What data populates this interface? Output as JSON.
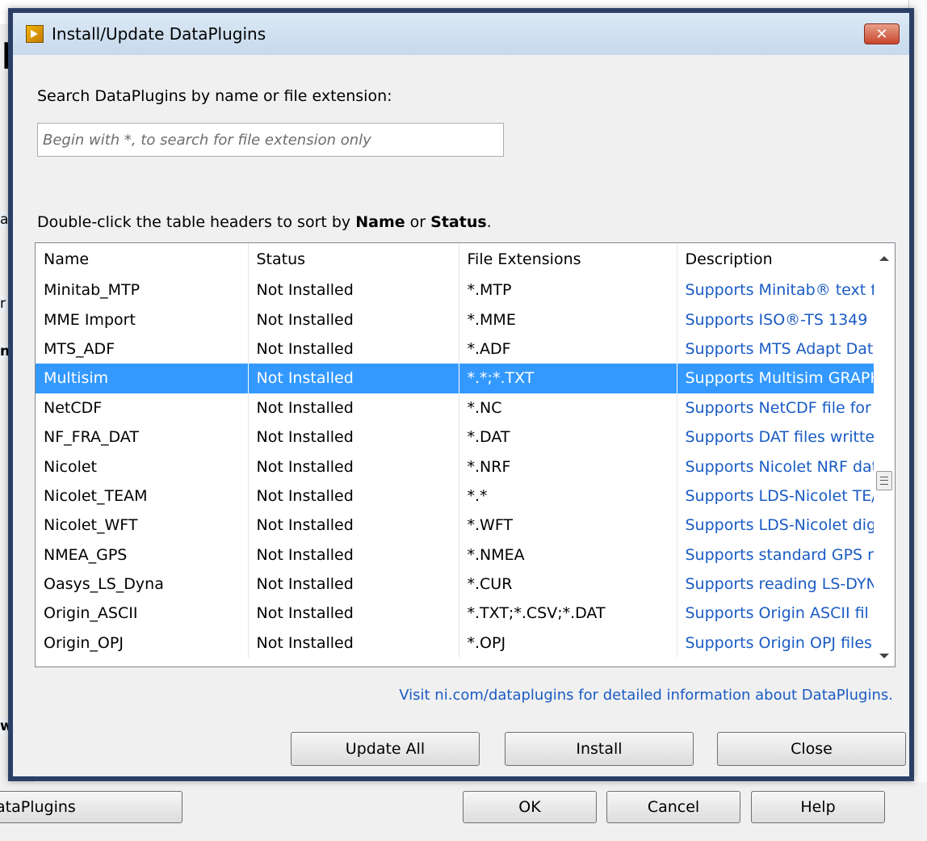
{
  "background": {
    "left_glyph": "n",
    "slivers": [
      "a",
      "r",
      "n",
      "w"
    ],
    "dataplugins_button": "ataPlugins",
    "ok_button": "OK",
    "cancel_button": "Cancel",
    "help_button": "Help"
  },
  "dialog": {
    "title": "Install/Update DataPlugins",
    "close_label": "✕",
    "search_label": "Search DataPlugins by name or file extension:",
    "search_placeholder": "Begin with *, to search for file extension only",
    "sort_hint_prefix": "Double-click the table headers to sort by ",
    "sort_hint_name": "Name",
    "sort_hint_or": " or ",
    "sort_hint_status": "Status",
    "sort_hint_suffix": ".",
    "table": {
      "columns": [
        "Name",
        "Status",
        "File Extensions",
        "Description"
      ],
      "rows": [
        {
          "name": "Minitab_MTP",
          "status": "Not Installed",
          "ext": "*.MTP",
          "desc": "Supports Minitab® text f"
        },
        {
          "name": "MME Import",
          "status": "Not Installed",
          "ext": "*.MME",
          "desc": "Supports ISO®-TS 1349"
        },
        {
          "name": "MTS_ADF",
          "status": "Not Installed",
          "ext": "*.ADF",
          "desc": "Supports MTS Adapt Dat"
        },
        {
          "name": "Multisim",
          "status": "Not Installed",
          "ext": "*.*;*.TXT",
          "desc": "Supports Multisim GRAPH"
        },
        {
          "name": "NetCDF",
          "status": "Not Installed",
          "ext": "*.NC",
          "desc": "Supports NetCDF file for"
        },
        {
          "name": "NF_FRA_DAT",
          "status": "Not Installed",
          "ext": "*.DAT",
          "desc": "Supports DAT files writte"
        },
        {
          "name": "Nicolet",
          "status": "Not Installed",
          "ext": "*.NRF",
          "desc": "Supports Nicolet NRF dat"
        },
        {
          "name": "Nicolet_TEAM",
          "status": "Not Installed",
          "ext": "*.*",
          "desc": "Supports LDS-Nicolet TE/"
        },
        {
          "name": "Nicolet_WFT",
          "status": "Not Installed",
          "ext": "*.WFT",
          "desc": "Supports LDS-Nicolet dig"
        },
        {
          "name": "NMEA_GPS",
          "status": "Not Installed",
          "ext": "*.NMEA",
          "desc": "Supports standard GPS r"
        },
        {
          "name": "Oasys_LS_Dyna",
          "status": "Not Installed",
          "ext": "*.CUR",
          "desc": "Supports reading LS-DYN"
        },
        {
          "name": "Origin_ASCII",
          "status": "Not Installed",
          "ext": "*.TXT;*.CSV;*.DAT",
          "desc": "Supports Origin ASCII fil"
        },
        {
          "name": "Origin_OPJ",
          "status": "Not Installed",
          "ext": "*.OPJ",
          "desc": "Supports Origin OPJ files"
        }
      ],
      "selected_row": 3
    },
    "info_link": "Visit ni.com/dataplugins for detailed information about DataPlugins.",
    "buttons": {
      "update_all": "Update All",
      "install": "Install",
      "close": "Close"
    }
  }
}
